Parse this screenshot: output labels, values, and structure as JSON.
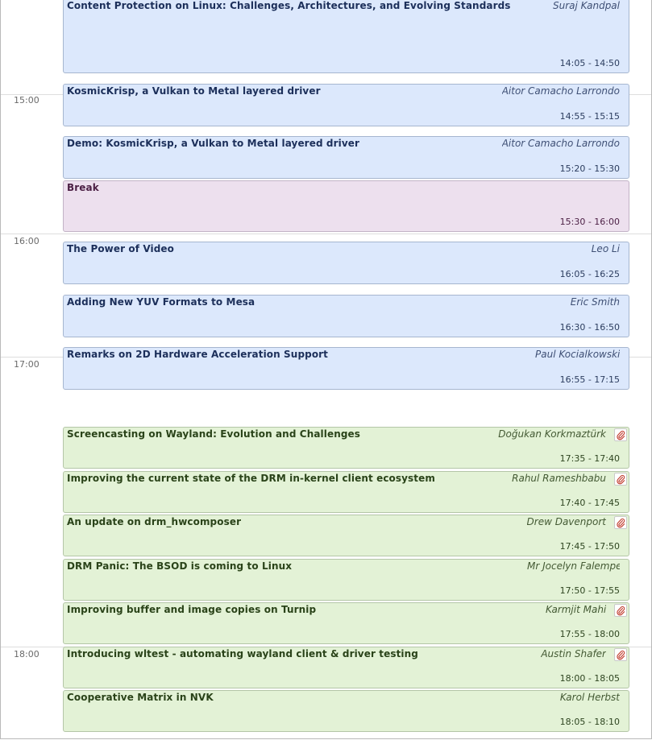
{
  "hours": [
    "15:00",
    "16:00",
    "17:00",
    "18:00"
  ],
  "events": [
    {
      "title": "Content Protection on Linux: Challenges, Architectures, and Evolving Standards",
      "speaker": "Suraj Kandpal",
      "time": "14:05 - 14:50",
      "kind": "talk"
    },
    {
      "title": "KosmicKrisp, a Vulkan to Metal layered driver",
      "speaker": "Aitor Camacho Larrondo",
      "time": "14:55 - 15:15",
      "kind": "talk"
    },
    {
      "title": "Demo: KosmicKrisp, a Vulkan to Metal layered driver",
      "speaker": "Aitor Camacho Larrondo",
      "time": "15:20 - 15:30",
      "kind": "talk"
    },
    {
      "title": "Break",
      "speaker": "",
      "time": "15:30 - 16:00",
      "kind": "break"
    },
    {
      "title": "The Power of Video",
      "speaker": "Leo Li",
      "time": "16:05 - 16:25",
      "kind": "talk"
    },
    {
      "title": "Adding New YUV Formats to Mesa",
      "speaker": "Eric Smith",
      "time": "16:30 - 16:50",
      "kind": "talk"
    },
    {
      "title": "Remarks on 2D Hardware Acceleration Support",
      "speaker": "Paul Kocialkowski",
      "time": "16:55 - 17:15",
      "kind": "talk"
    },
    {
      "title": "Screencasting on Wayland: Evolution and Challenges",
      "speaker": "Doğukan Korkmaztürk",
      "time": "17:35 - 17:40",
      "kind": "lightning",
      "attachment": true
    },
    {
      "title": "Improving the current state of the DRM in-kernel client ecosystem",
      "speaker": "Rahul Rameshbabu",
      "time": "17:40 - 17:45",
      "kind": "lightning",
      "attachment": true
    },
    {
      "title": "An update on drm_hwcomposer",
      "speaker": "Drew Davenport",
      "time": "17:45 - 17:50",
      "kind": "lightning",
      "attachment": true
    },
    {
      "title": "DRM Panic: The BSOD is coming to Linux",
      "speaker": "Mr Jocelyn Falempe",
      "time": "17:50 - 17:55",
      "kind": "lightning",
      "attachment": false
    },
    {
      "title": "Improving buffer and image copies on Turnip",
      "speaker": "Karmjit Mahil",
      "time": "17:55 - 18:00",
      "kind": "lightning",
      "attachment": true
    },
    {
      "title": "Introducing wltest - automating wayland client & driver testing",
      "speaker": "Austin Shafer",
      "time": "18:00 - 18:05",
      "kind": "lightning",
      "attachment": true
    },
    {
      "title": "Cooperative Matrix in NVK",
      "speaker": "Karol Herbst",
      "time": "18:05 - 18:10",
      "kind": "lightning",
      "attachment": false
    }
  ],
  "icons": {
    "attachment": "paperclip-icon"
  },
  "colors": {
    "talk": "#dce8fc",
    "break": "#ede0ee",
    "lightning": "#e3f2d6"
  }
}
